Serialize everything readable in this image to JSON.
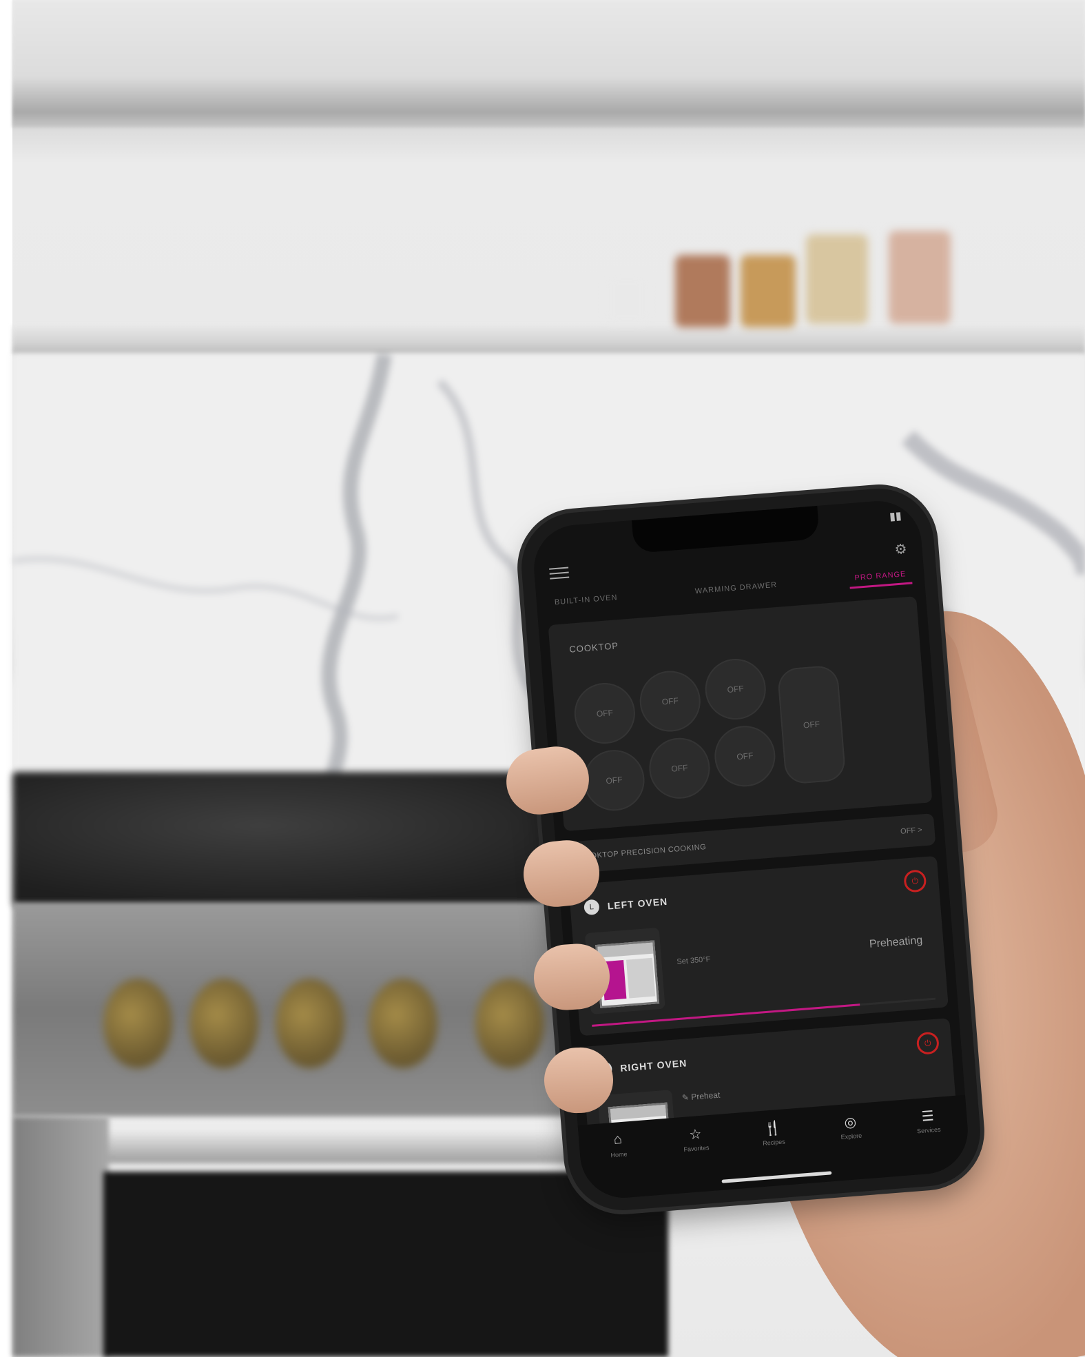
{
  "app": {
    "tabs": [
      {
        "label": "BUILT-IN OVEN"
      },
      {
        "label": "WARMING DRAWER"
      },
      {
        "label": "PRO RANGE"
      }
    ],
    "active_tab_index": 2,
    "cooktop": {
      "title": "COOKTOP",
      "burners": [
        "OFF",
        "OFF",
        "OFF",
        "OFF",
        "OFF",
        "OFF"
      ],
      "griddle": "OFF"
    },
    "precision": {
      "label": "COOKTOP PRECISION COOKING",
      "value": "OFF >"
    },
    "left_oven": {
      "badge": "L",
      "name": "LEFT OVEN",
      "meta": "Set 350°F",
      "mode": "Preheating",
      "progress": 0.78
    },
    "right_oven": {
      "badge": "R",
      "name": "RIGHT OVEN",
      "meta": "Preheat"
    },
    "bottom_nav": [
      {
        "label": "Home",
        "icon": "⌂"
      },
      {
        "label": "Favorites",
        "icon": "☆"
      },
      {
        "label": "Recipes",
        "icon": "🍴"
      },
      {
        "label": "Explore",
        "icon": "◎"
      },
      {
        "label": "Services",
        "icon": "☰"
      }
    ],
    "colors": {
      "accent": "#c21883",
      "power": "#c82020"
    }
  }
}
